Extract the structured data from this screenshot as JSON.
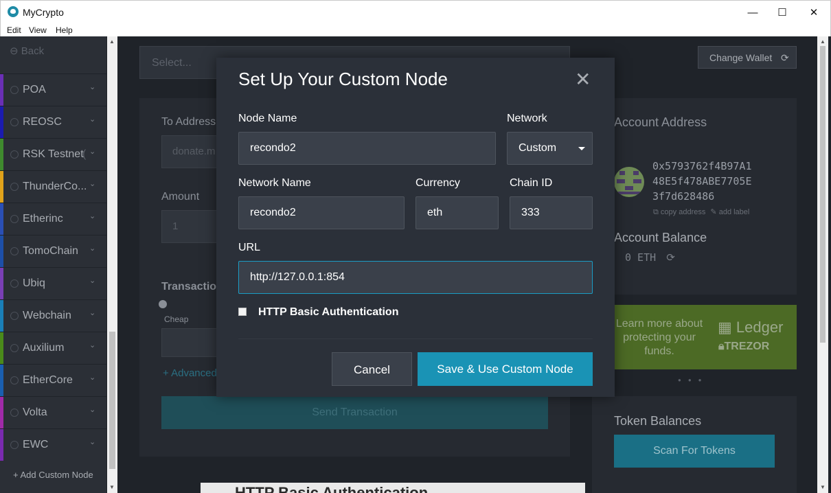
{
  "window": {
    "title": "MyCrypto",
    "minimize_glyph": "—",
    "maximize_glyph": "☐",
    "close_glyph": "✕"
  },
  "menu": [
    "Edit",
    "View",
    "Help"
  ],
  "sidebar": {
    "back_label": "Back",
    "items": [
      {
        "label": "POA",
        "color": "#6a2fb5"
      },
      {
        "label": "REOSC",
        "color": "#1b1bb0"
      },
      {
        "label": "RSK Testnet",
        "suffix": "(",
        "color": "#3f8a2e"
      },
      {
        "label": "ThunderCo...",
        "color": "#e0a21a"
      },
      {
        "label": "Etherinc",
        "color": "#2a4fb5"
      },
      {
        "label": "TomoChain",
        "color": "#1d4fa8"
      },
      {
        "label": "Ubiq",
        "color": "#7a3fb5"
      },
      {
        "label": "Webchain",
        "color": "#1a7fb8"
      },
      {
        "label": "Auxilium",
        "color": "#4a8a1a"
      },
      {
        "label": "EtherCore",
        "color": "#1a5fb0"
      },
      {
        "label": "Volta",
        "color": "#a02aa8"
      },
      {
        "label": "EWC",
        "color": "#7a2ab0"
      }
    ],
    "add_custom_node": "+ Add Custom Node"
  },
  "background": {
    "select_placeholder": "Select...",
    "to_address_label": "To Address",
    "to_address_placeholder": "donate.m",
    "amount_label": "Amount",
    "amount_placeholder": "1",
    "transaction_label": "Transaction",
    "cheap_label": "Cheap",
    "advanced_label": "+ Advanced",
    "send_button": "Send Transaction",
    "change_wallet": "Change Wallet",
    "account_address_title": "Account Address",
    "account_address": [
      "0x5793762f4B97A1",
      "48E5f478ABE7705E",
      "3f7d628486"
    ],
    "copy_address": "copy address",
    "add_label": "add label",
    "account_balance_title": "Account Balance",
    "balance": "0 ETH",
    "promo_text": "Learn more about protecting your funds.",
    "ledger": "Ledger",
    "trezor": "TREZOR",
    "token_balances_title": "Token Balances",
    "scan_button": "Scan For Tokens",
    "bottom_peek_text": "HTTP Basic Authentication"
  },
  "modal": {
    "title": "Set Up Your Custom Node",
    "node_name_label": "Node Name",
    "node_name_value": "recondo2",
    "network_label": "Network",
    "network_value": "Custom",
    "network_name_label": "Network Name",
    "network_name_value": "recondo2",
    "currency_label": "Currency",
    "currency_value": "eth",
    "chain_id_label": "Chain ID",
    "chain_id_value": "333",
    "url_label": "URL",
    "url_value": "http://127.0.0.1:854",
    "http_auth_label": "HTTP Basic Authentication",
    "http_auth_checked": false,
    "cancel_button": "Cancel",
    "save_button": "Save & Use Custom Node"
  },
  "colors": {
    "accent": "#1a93b5",
    "background": "#1f2329",
    "modal": "#2b3039"
  }
}
